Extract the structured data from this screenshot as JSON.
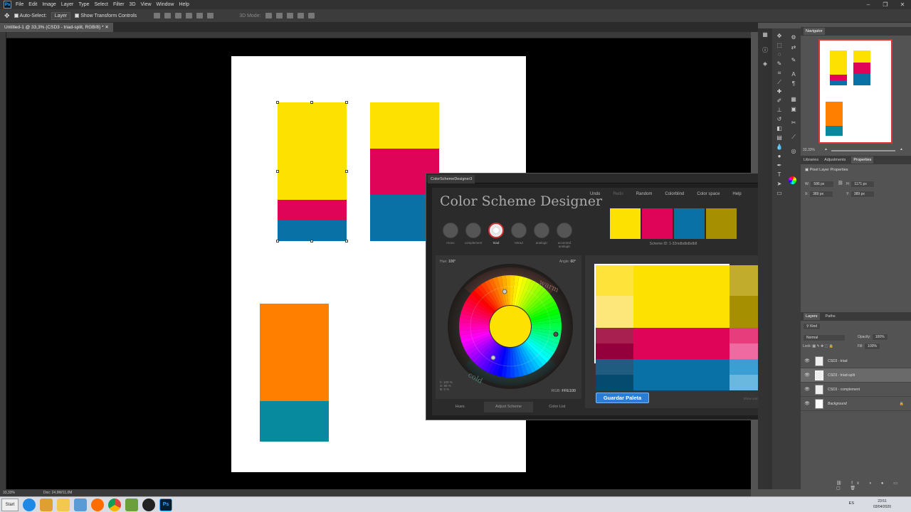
{
  "menubar": {
    "items": [
      "File",
      "Edit",
      "Image",
      "Layer",
      "Type",
      "Select",
      "Filter",
      "3D",
      "View",
      "Window",
      "Help"
    ]
  },
  "options_bar": {
    "auto_select_label": "Auto-Select:",
    "auto_select_value": "Layer",
    "show_transform_label": "Show Transform Controls",
    "mode_3d": "3D Mode:"
  },
  "document": {
    "tab_title": "Untitled-1 @ 33,3% (CSD3 - triad-split, RGB/8) *",
    "zoom": "33,33%",
    "doc_size": "Doc: 24,9M/11,0M"
  },
  "csd": {
    "tab_title": "ColorSchemeDesigner3",
    "title": "Color Scheme Designer",
    "menu": [
      "Undo",
      "Redo",
      "Random",
      "Colorblind",
      "Color space",
      "Help"
    ],
    "schemes": [
      {
        "label": "mono",
        "active": false
      },
      {
        "label": "complement",
        "active": false
      },
      {
        "label": "triad",
        "active": true
      },
      {
        "label": "tetrad",
        "active": false
      },
      {
        "label": "analogic",
        "active": false
      },
      {
        "label": "accented analogic",
        "active": false
      }
    ],
    "palette": [
      "#fde100",
      "#df0457",
      "#0a71a6",
      "#a68f00"
    ],
    "scheme_id": "Scheme ID: 1-32mdbdbdbdb8",
    "hue_label": "Hue:",
    "hue_value": "100°",
    "angle_label": "Angle:",
    "angle_value": "60°",
    "wheel_warm": "warm",
    "wheel_cold": "cold",
    "hsv_readout": [
      "h: 100 %",
      "S: 98 %",
      "B: 0 %"
    ],
    "rgb_label": "RGB:",
    "rgb_value": "FFE100",
    "bottom_tabs": [
      "Hues",
      "Adjust Scheme",
      "Color List"
    ],
    "save_button": "Guardar Paleta",
    "sample_text": "Show sample text"
  },
  "navigator": {
    "title": "Navigator",
    "zoom": "33,33%"
  },
  "properties": {
    "tabs": [
      "Libraries",
      "Adjustments",
      "Properties"
    ],
    "section": "Pixel Layer Properties",
    "w_label": "W:",
    "w_value": "586 px",
    "h_label": "H:",
    "h_value": "1171 px",
    "x_label": "X:",
    "x_value": "389 px",
    "y_label": "Y:",
    "y_value": "389 px"
  },
  "layers_panel": {
    "tabs": [
      "Layers",
      "Paths"
    ],
    "kind": "Kind",
    "blend": "Normal",
    "opacity_label": "Opacity:",
    "opacity_value": "100%",
    "lock_label": "Lock:",
    "fill_label": "Fill:",
    "fill_value": "100%",
    "layers": [
      {
        "name": "CSD3 - triad",
        "selected": false
      },
      {
        "name": "CSD3 - triad-split",
        "selected": true
      },
      {
        "name": "CSD3 - complement",
        "selected": false
      },
      {
        "name": "Background",
        "selected": false
      }
    ]
  },
  "taskbar": {
    "start_label": "Start",
    "lang": "ES",
    "time": "23:51",
    "date": "03/04/2020"
  }
}
